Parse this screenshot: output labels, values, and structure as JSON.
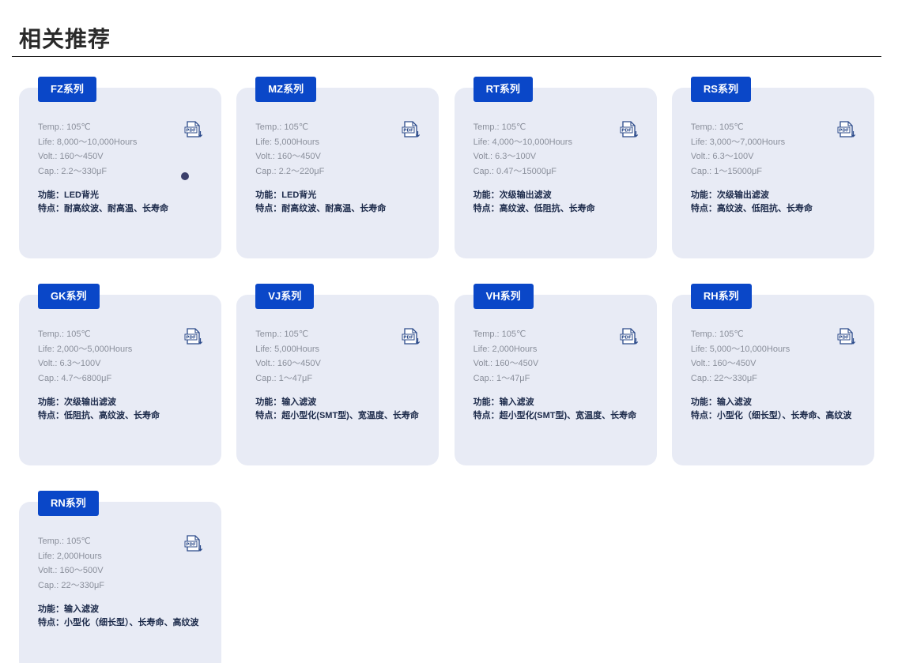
{
  "section": {
    "title": "相关推荐"
  },
  "cards": [
    {
      "series": "FZ系列",
      "temp_label": "Temp.:",
      "temp": "105℃",
      "life_label": "Life:",
      "life": "8,000～10,000Hours",
      "volt_label": "Volt.:",
      "volt": "160～450V",
      "cap_label": "Cap.:",
      "cap": "2.2～330μF",
      "function_label": "功能：",
      "function": "LED背光",
      "features_label": "特点：",
      "features": "耐高纹波、耐高温、长寿命",
      "pdf_icon": "pdf-download-icon"
    },
    {
      "series": "MZ系列",
      "temp_label": "Temp.:",
      "temp": "105℃",
      "life_label": "Life:",
      "life": "5,000Hours",
      "volt_label": "Volt.:",
      "volt": "160～450V",
      "cap_label": "Cap.:",
      "cap": "2.2～220μF",
      "function_label": "功能：",
      "function": "LED背光",
      "features_label": "特点：",
      "features": "耐高纹波、耐高温、长寿命",
      "pdf_icon": "pdf-download-icon"
    },
    {
      "series": "RT系列",
      "temp_label": "Temp.:",
      "temp": "105℃",
      "life_label": "Life:",
      "life": "4,000～10,000Hours",
      "volt_label": "Volt.:",
      "volt": "6.3～100V",
      "cap_label": "Cap.:",
      "cap": "0.47～15000μF",
      "function_label": "功能：",
      "function": "次级输出滤波",
      "features_label": "特点：",
      "features": "高纹波、低阻抗、长寿命",
      "pdf_icon": "pdf-download-icon"
    },
    {
      "series": "RS系列",
      "temp_label": "Temp.:",
      "temp": "105℃",
      "life_label": "Life:",
      "life": "3,000～7,000Hours",
      "volt_label": "Volt.:",
      "volt": "6.3～100V",
      "cap_label": "Cap.:",
      "cap": "1～15000μF",
      "function_label": "功能：",
      "function": "次级输出滤波",
      "features_label": "特点：",
      "features": "高纹波、低阻抗、长寿命",
      "pdf_icon": "pdf-download-icon"
    },
    {
      "series": "GK系列",
      "temp_label": "Temp.:",
      "temp": "105℃",
      "life_label": "Life:",
      "life": "2,000～5,000Hours",
      "volt_label": "Volt.:",
      "volt": "6.3～100V",
      "cap_label": "Cap.:",
      "cap": "4.7～6800μF",
      "function_label": "功能：",
      "function": "次级输出滤波",
      "features_label": "特点：",
      "features": "低阻抗、高纹波、长寿命",
      "pdf_icon": "pdf-download-icon"
    },
    {
      "series": "VJ系列",
      "temp_label": "Temp.:",
      "temp": "105℃",
      "life_label": "Life:",
      "life": "5,000Hours",
      "volt_label": "Volt.:",
      "volt": "160～450V",
      "cap_label": "Cap.:",
      "cap": "1～47μF",
      "function_label": "功能：",
      "function": "输入滤波",
      "features_label": "特点：",
      "features": "超小型化(SMT型)、宽温度、长寿命",
      "pdf_icon": "pdf-download-icon"
    },
    {
      "series": "VH系列",
      "temp_label": "Temp.:",
      "temp": "105℃",
      "life_label": "Life:",
      "life": "2,000Hours",
      "volt_label": "Volt.:",
      "volt": "160～450V",
      "cap_label": "Cap.:",
      "cap": "1～47μF",
      "function_label": "功能：",
      "function": "输入滤波",
      "features_label": "特点：",
      "features": "超小型化(SMT型)、宽温度、长寿命",
      "pdf_icon": "pdf-download-icon"
    },
    {
      "series": "RH系列",
      "temp_label": "Temp.:",
      "temp": "105℃",
      "life_label": "Life:",
      "life": "5,000～10,000Hours",
      "volt_label": "Volt.:",
      "volt": "160～450V",
      "cap_label": "Cap.:",
      "cap": "22～330μF",
      "function_label": "功能：",
      "function": "输入滤波",
      "features_label": "特点：",
      "features": "小型化（细长型）、长寿命、高纹波",
      "pdf_icon": "pdf-download-icon"
    },
    {
      "series": "RN系列",
      "temp_label": "Temp.:",
      "temp": "105℃",
      "life_label": "Life:",
      "life": "2,000Hours",
      "volt_label": "Volt.:",
      "volt": "160～500V",
      "cap_label": "Cap.:",
      "cap": "22～330μF",
      "function_label": "功能：",
      "function": "输入滤波",
      "features_label": "特点：",
      "features": "小型化（细长型）、长寿命、高纹波",
      "pdf_icon": "pdf-download-icon"
    }
  ],
  "colors": {
    "badge": "#0a47c8",
    "card_bg": "#e8ebf5",
    "spec_text": "#8a8f9b",
    "desc_text": "#1c2a4a",
    "pdf_icon": "#2b4a8a"
  }
}
